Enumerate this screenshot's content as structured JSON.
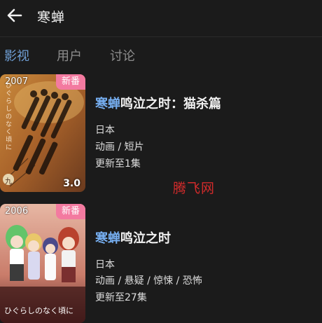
{
  "header": {
    "title": "寒蝉",
    "back_icon": "arrow-left-icon"
  },
  "tabs": [
    {
      "label": "影视",
      "active": true
    },
    {
      "label": "用户",
      "active": false
    },
    {
      "label": "讨论",
      "active": false
    }
  ],
  "accent_color": "#6f9fd6",
  "badge_color": "#f37aa0",
  "results": [
    {
      "title_highlight": "寒蝉",
      "title_rest": "鸣泣之时：猫杀篇",
      "region": "日本",
      "genres": "动画 / 短片",
      "status": "更新至1集",
      "year": "2007",
      "badge": "新番",
      "rating": "3.0",
      "poster_text": "ひぐらしのなく頃に",
      "poster_seal": "九"
    },
    {
      "title_highlight": "寒蝉",
      "title_rest": "鸣泣之时",
      "region": "日本",
      "genres": "动画 / 悬疑 / 惊悚 / 恐怖",
      "status": "更新至27集",
      "year": "2006",
      "badge": "新番",
      "poster_text": "ひぐらしのなく頃に"
    }
  ],
  "watermark": "腾飞网"
}
